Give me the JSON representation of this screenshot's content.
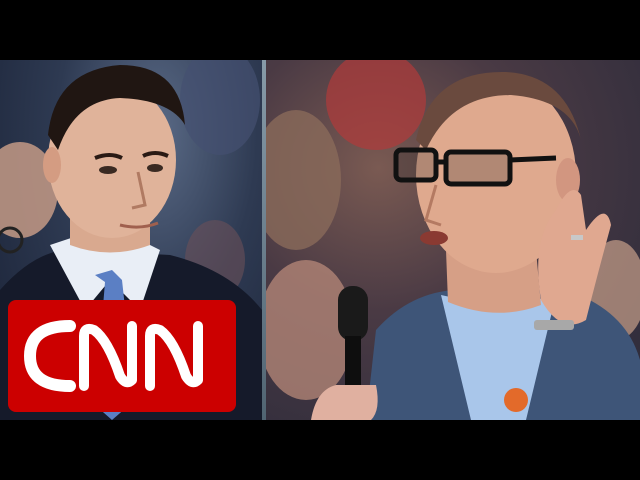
{
  "broadcast": {
    "network_logo_text": "CNN",
    "logo_colors": {
      "bg": "#cc0000",
      "stroke": "#ffffff"
    }
  },
  "scene": {
    "left_panel": "man-in-suit-listening",
    "right_panel": "man-with-glasses-speaking-into-microphone"
  }
}
